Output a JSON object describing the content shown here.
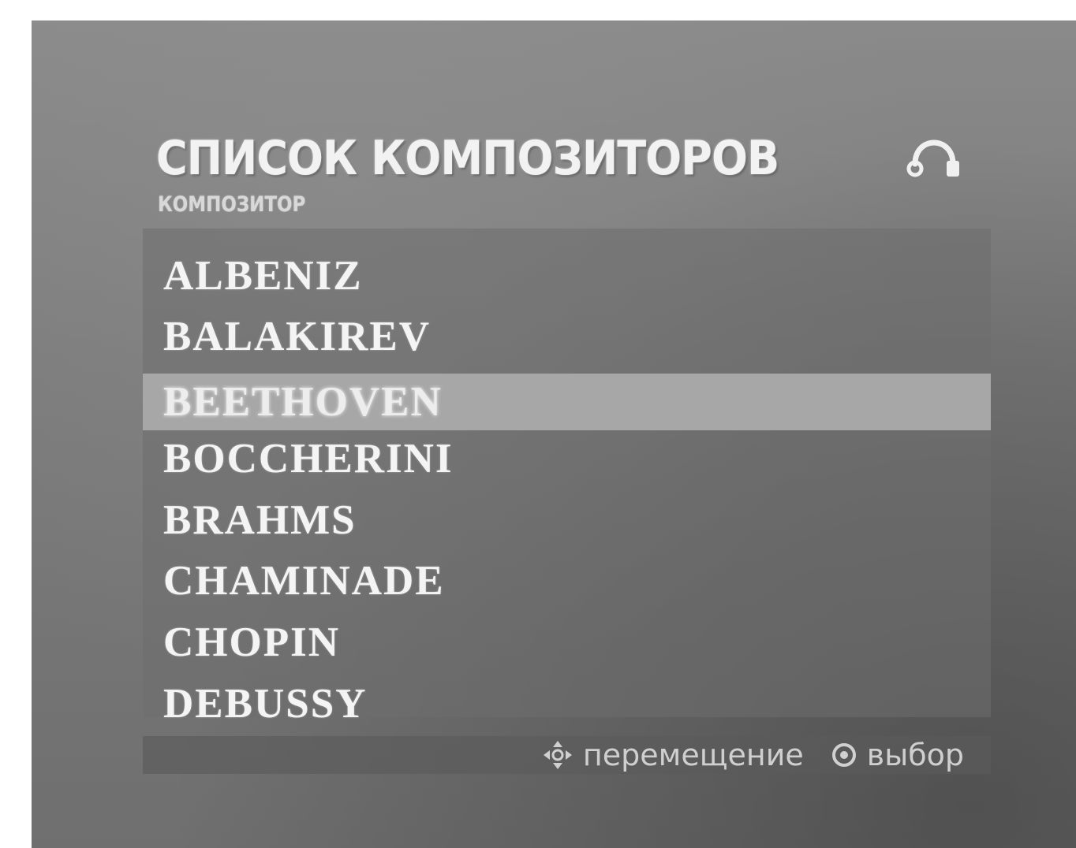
{
  "header": {
    "title": "СПИСОК КОМПОЗИТОРОВ",
    "subtitle": "КОМПОЗИТОР",
    "icon": "headphone-icon"
  },
  "composers": {
    "items": [
      {
        "label": "ALBENIZ"
      },
      {
        "label": "BALAKIREV"
      },
      {
        "label": "BEETHOVEN"
      },
      {
        "label": "BOCCHERINI"
      },
      {
        "label": "BRAHMS"
      },
      {
        "label": "CHAMINADE"
      },
      {
        "label": "CHOPIN"
      },
      {
        "label": "DEBUSSY"
      }
    ],
    "selected_label": "BEETHOVEN"
  },
  "footer": {
    "move_icon": "dpad-icon",
    "move_label": "перемещение",
    "select_icon": "enter-icon",
    "select_label": "выбор"
  },
  "colors": {
    "selection": "#a7a7a7",
    "text": "#f4f4f4"
  }
}
